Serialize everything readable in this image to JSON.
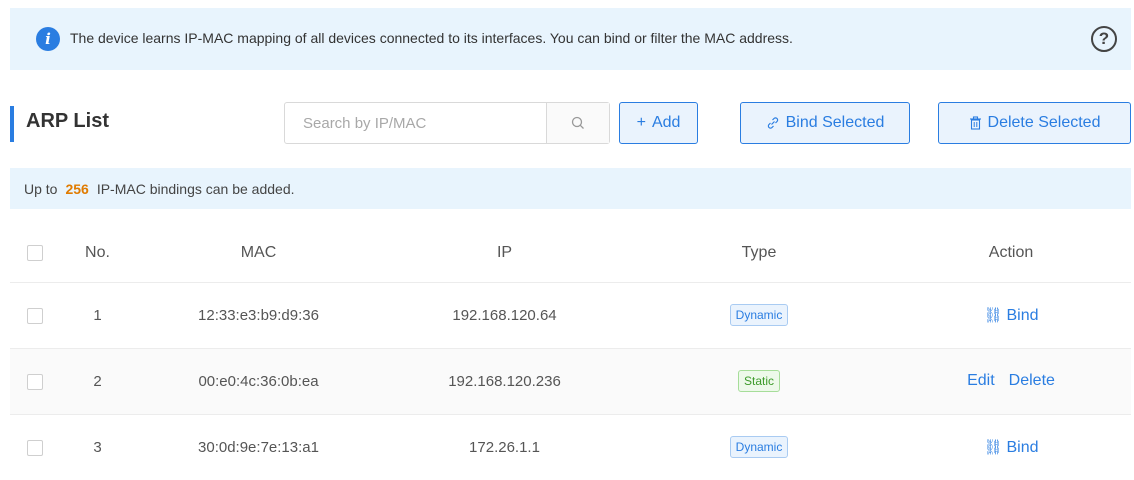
{
  "info": {
    "message": "The device learns IP-MAC mapping of all devices connected to its interfaces. You can bind or filter the MAC address.",
    "info_icon": "i",
    "help_icon": "?"
  },
  "header": {
    "title": "ARP List"
  },
  "search": {
    "placeholder": "Search by IP/MAC",
    "icon": "search-icon"
  },
  "buttons": {
    "add_icon": "+",
    "add_label": "Add",
    "bind_icon": "⛓",
    "bind_label": "Bind Selected",
    "delete_icon": "🗑",
    "delete_label": "Delete Selected"
  },
  "limit": {
    "prefix": "Up to",
    "count": "256",
    "suffix": "IP-MAC bindings can be added."
  },
  "table": {
    "columns": [
      "No.",
      "MAC",
      "IP",
      "Type",
      "Action"
    ],
    "rows": [
      {
        "no": "1",
        "mac": "12:33:e3:b9:d9:36",
        "ip": "192.168.120.64",
        "type": "Dynamic",
        "actions": [
          "Bind"
        ]
      },
      {
        "no": "2",
        "mac": "00:e0:4c:36:0b:ea",
        "ip": "192.168.120.236",
        "type": "Static",
        "actions": [
          "Edit",
          "Delete"
        ]
      },
      {
        "no": "3",
        "mac": "30:0d:9e:7e:13:a1",
        "ip": "172.26.1.1",
        "type": "Dynamic",
        "actions": [
          "Bind"
        ]
      }
    ]
  },
  "colors": {
    "accent": "#2a7de1",
    "info_bg": "#e8f4fd",
    "limit_highlight": "#e07b00",
    "static_green": "#3c9a2a"
  }
}
